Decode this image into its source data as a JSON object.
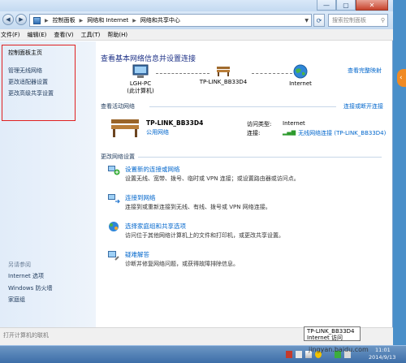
{
  "window": {
    "controls": {
      "minimize": "—",
      "maximize": "▢",
      "close": "✕"
    }
  },
  "address": {
    "crumbs": [
      "控制面板",
      "网络和 Internet",
      "网络和共享中心"
    ],
    "search_placeholder": "搜索控制面板"
  },
  "menu": [
    "文件(F)",
    "编辑(E)",
    "查看(V)",
    "工具(T)",
    "帮助(H)"
  ],
  "sidebar": {
    "items": [
      "控制面板主页",
      "管理无线网络",
      "更改适配器设置",
      "更改高级共享设置"
    ],
    "see_also_label": "另请参阅",
    "see_also_items": [
      "Internet 选项",
      "Windows 防火墙",
      "家庭组"
    ]
  },
  "main": {
    "title": "查看基本网络信息并设置连接",
    "full_map_link": "查看完整映射",
    "map": {
      "pc_name": "LGH-PC",
      "pc_sub": "(此计算机)",
      "router_name": "TP-LINK_BB33D4",
      "internet_name": "Internet"
    },
    "active": {
      "header": "查看活动网络",
      "connect_link": "连接或断开连接",
      "network_name": "TP-LINK_BB33D4",
      "network_type": "公用网络",
      "access_label": "访问类型:",
      "access_value": "Internet",
      "conn_label": "连接:",
      "conn_value": "无线网络连接 (TP-LINK_BB33D4)"
    },
    "settings": {
      "header": "更改网络设置",
      "tasks": [
        {
          "title": "设置新的连接或网络",
          "desc": "设置无线、宽带、拨号、临时或 VPN 连接；或设置路由器或访问点。"
        },
        {
          "title": "连接到网络",
          "desc": "连接到或重新连接到无线、有线、拨号或 VPN 网络连接。"
        },
        {
          "title": "选择家庭组和共享选项",
          "desc": "访问位于其他网络计算机上的文件和打印机，或更改共享设置。"
        },
        {
          "title": "疑难解答",
          "desc": "诊断并修复网络问题，或获得故障排除信息。"
        }
      ]
    }
  },
  "statusbar": {
    "text": "打开计算机的联机"
  },
  "taskbar": {
    "tray_tooltip_line1": "TP-LINK_BB33D4",
    "tray_tooltip_line2": "Internet 访问",
    "time": "11:01",
    "date": "2014/9/13",
    "watermark": "jingyan.baidu.com"
  },
  "colors": {
    "highlight_box": "#e02020",
    "link": "#0066cc",
    "title": "#1e3287"
  }
}
